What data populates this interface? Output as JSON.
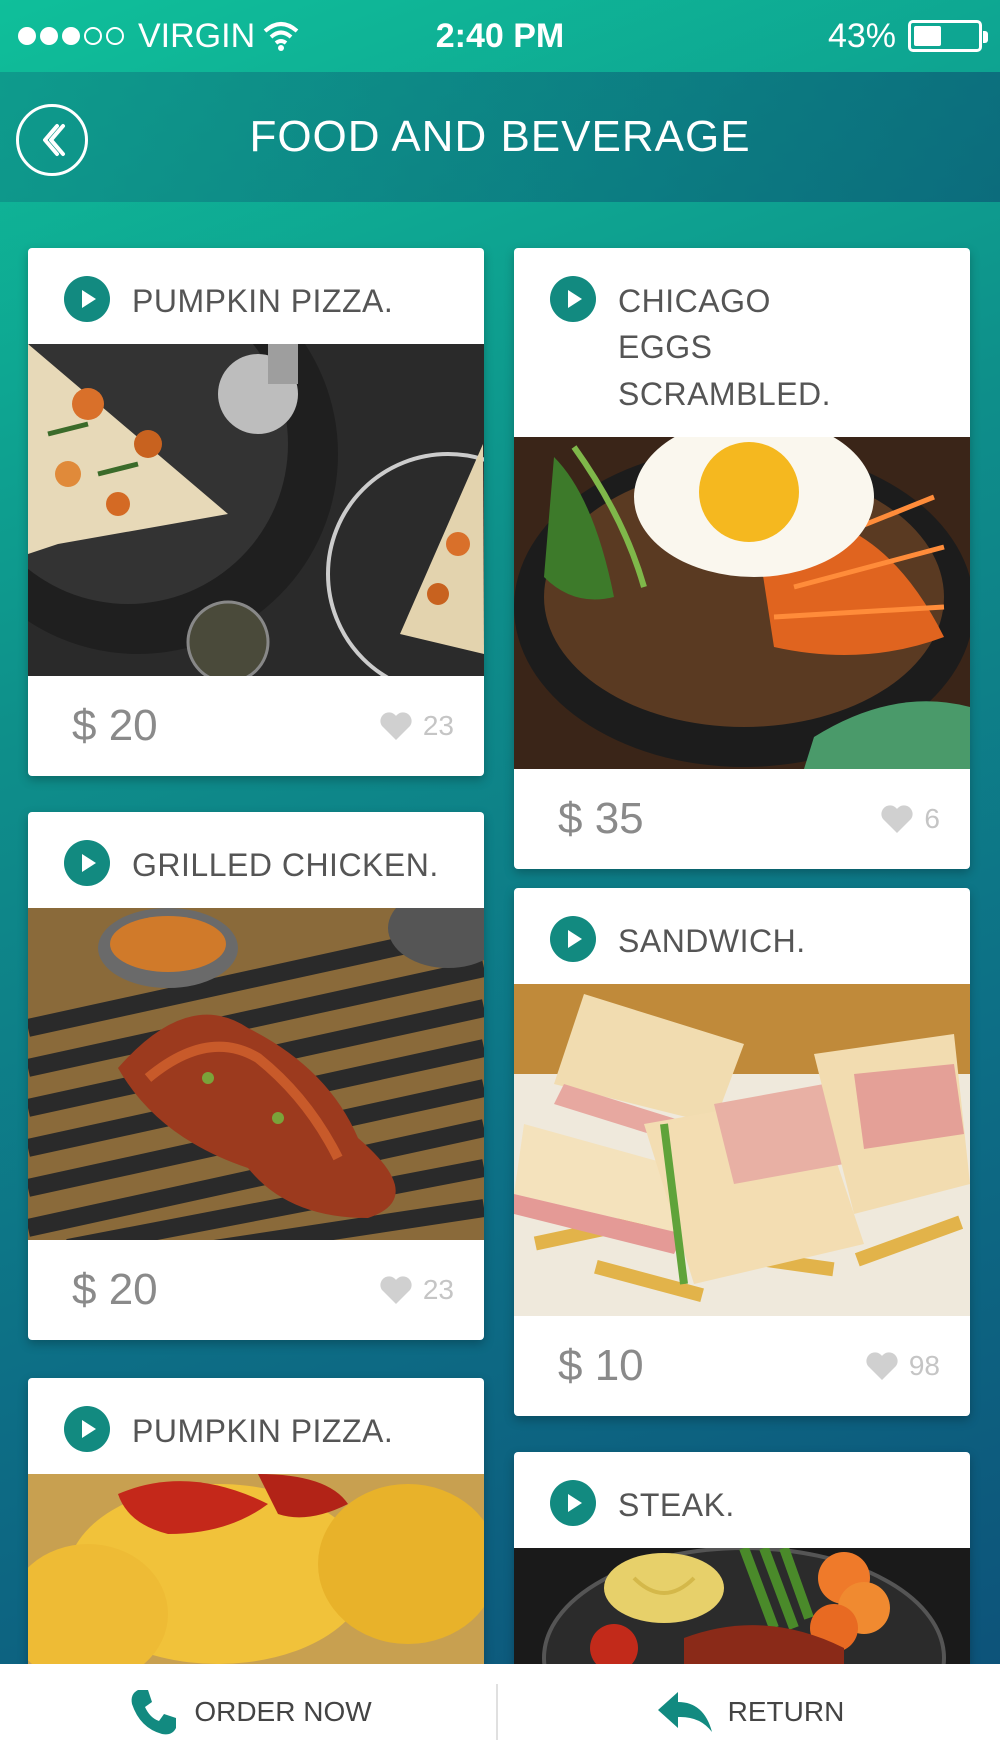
{
  "status_bar": {
    "carrier": "VIRGIN",
    "time": "2:40 PM",
    "battery": "43%",
    "battery_level": 0.43,
    "signal_strength": 3,
    "signal_max": 5
  },
  "header": {
    "title": "FOOD AND BEVERAGE",
    "back_icon": "chevron-left-circle-icon"
  },
  "cards": [
    {
      "title": "PUMPKIN PIZZA.",
      "price": "$ 20",
      "likes": "23",
      "image": "pizza-photo"
    },
    {
      "title": "CHICAGO EGGS SCRAMBLED.",
      "price": "$ 35",
      "likes": "6",
      "image": "bibimbap-photo"
    },
    {
      "title": "GRILLED CHICKEN.",
      "price": "$ 20",
      "likes": "23",
      "image": "grilled-meat-photo"
    },
    {
      "title": "SANDWICH.",
      "price": "$ 10",
      "likes": "98",
      "image": "club-sandwich-photo"
    },
    {
      "title": "PUMPKIN PIZZA.",
      "image": "croquette-photo"
    },
    {
      "title": "STEAK.",
      "image": "steak-plate-photo"
    }
  ],
  "bottom_bar": {
    "order_label": "ORDER NOW",
    "return_label": "RETURN"
  },
  "colors": {
    "accent": "#128a80",
    "header_gradient_start": "#0fbf9a",
    "header_gradient_end": "#0d4f78"
  }
}
